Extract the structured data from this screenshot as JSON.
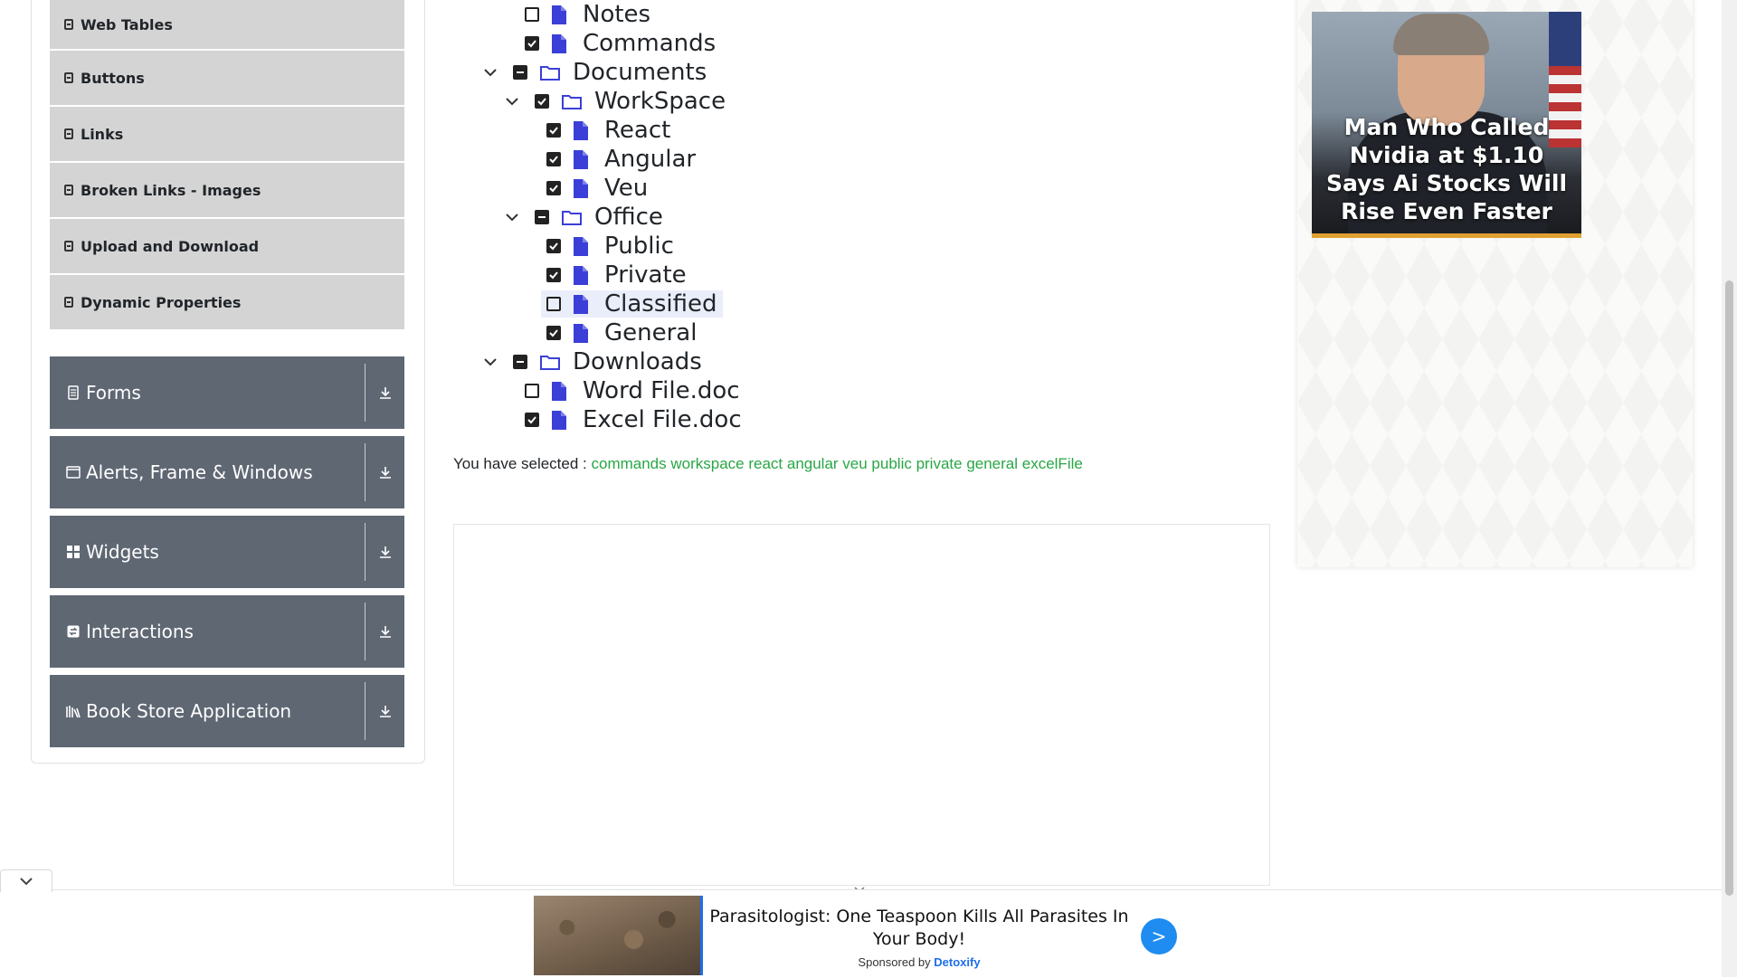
{
  "sidebar": {
    "elements_items": [
      {
        "label": "Web Tables"
      },
      {
        "label": "Buttons"
      },
      {
        "label": "Links"
      },
      {
        "label": "Broken Links - Images"
      },
      {
        "label": "Upload and Download"
      },
      {
        "label": "Dynamic Properties"
      }
    ],
    "groups": [
      {
        "label": "Forms",
        "icon": "form-icon"
      },
      {
        "label": "Alerts, Frame & Windows",
        "icon": "window-icon"
      },
      {
        "label": "Widgets",
        "icon": "widgets-icon"
      },
      {
        "label": "Interactions",
        "icon": "interactions-icon"
      },
      {
        "label": "Book Store Application",
        "icon": "bookstore-icon"
      }
    ]
  },
  "tree": {
    "nodes": [
      {
        "label": "Notes",
        "type": "file",
        "checked": "unchecked"
      },
      {
        "label": "Commands",
        "type": "file",
        "checked": "checked"
      },
      {
        "label": "Documents",
        "type": "folder",
        "checked": "half",
        "expanded": true
      },
      {
        "label": "WorkSpace",
        "type": "folder",
        "checked": "checked",
        "expanded": true
      },
      {
        "label": "React",
        "type": "file",
        "checked": "checked"
      },
      {
        "label": "Angular",
        "type": "file",
        "checked": "checked"
      },
      {
        "label": "Veu",
        "type": "file",
        "checked": "checked"
      },
      {
        "label": "Office",
        "type": "folder",
        "checked": "half",
        "expanded": true
      },
      {
        "label": "Public",
        "type": "file",
        "checked": "checked"
      },
      {
        "label": "Private",
        "type": "file",
        "checked": "checked"
      },
      {
        "label": "Classified",
        "type": "file",
        "checked": "unchecked",
        "highlighted": true
      },
      {
        "label": "General",
        "type": "file",
        "checked": "checked"
      },
      {
        "label": "Downloads",
        "type": "folder",
        "checked": "half",
        "expanded": true
      },
      {
        "label": "Word File.doc",
        "type": "file",
        "checked": "unchecked"
      },
      {
        "label": "Excel File.doc",
        "type": "file",
        "checked": "checked"
      }
    ]
  },
  "result": {
    "prefix": "You have selected :",
    "selected": "commands workspace react angular veu public private general excelFile"
  },
  "right_ad": {
    "headline": "Man Who Called Nvidia at $1.10 Says Ai Stocks Will Rise Even Faster"
  },
  "bottom_ad": {
    "text": "Parasitologist: One Teaspoon Kills All Parasites In Your Body!",
    "sponsored_prefix": "Sponsored by",
    "sponsor": "Detoxify",
    "button": ">"
  },
  "colors": {
    "group_bg": "#5f6773",
    "item_bg": "#d4d4d4",
    "file_icon": "#3b3fd8",
    "selected_text": "#28a745"
  }
}
